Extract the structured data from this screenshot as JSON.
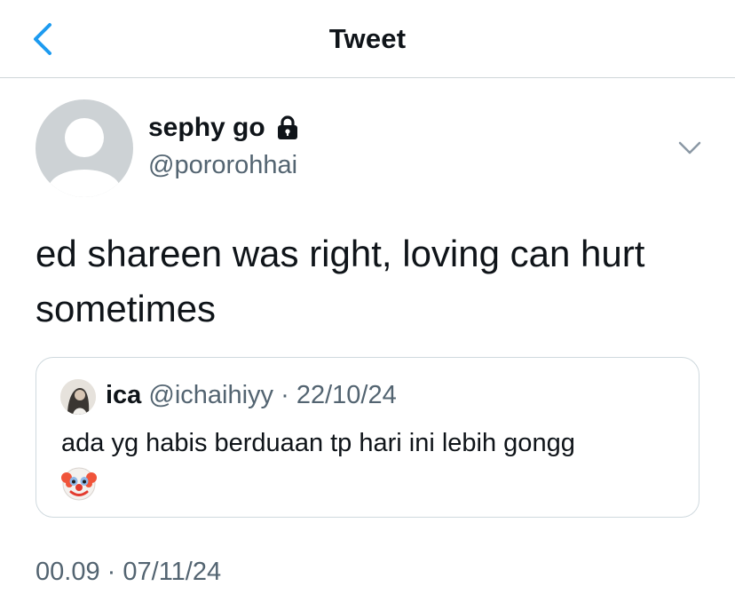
{
  "header": {
    "title": "Tweet",
    "back_icon": "chevron-left-icon",
    "accent_color": "#1d9bf0"
  },
  "tweet": {
    "author": {
      "name": "sephy go",
      "handle": "@pororohhai",
      "protected_icon": "lock-icon"
    },
    "text": "ed shareen was right, loving can hurt sometimes",
    "timestamp": {
      "time": "00.09",
      "separator": "·",
      "date": "07/11/24"
    }
  },
  "quoted_tweet": {
    "name": "ica",
    "handle": "@ichaihiyy",
    "separator": "·",
    "date": "22/10/24",
    "text": "ada yg habis berduaan tp hari ini lebih gongg",
    "emoji": "clown-face-emoji"
  },
  "colors": {
    "text_primary": "#0f1419",
    "text_secondary": "#536471",
    "border": "#cfd9de"
  }
}
